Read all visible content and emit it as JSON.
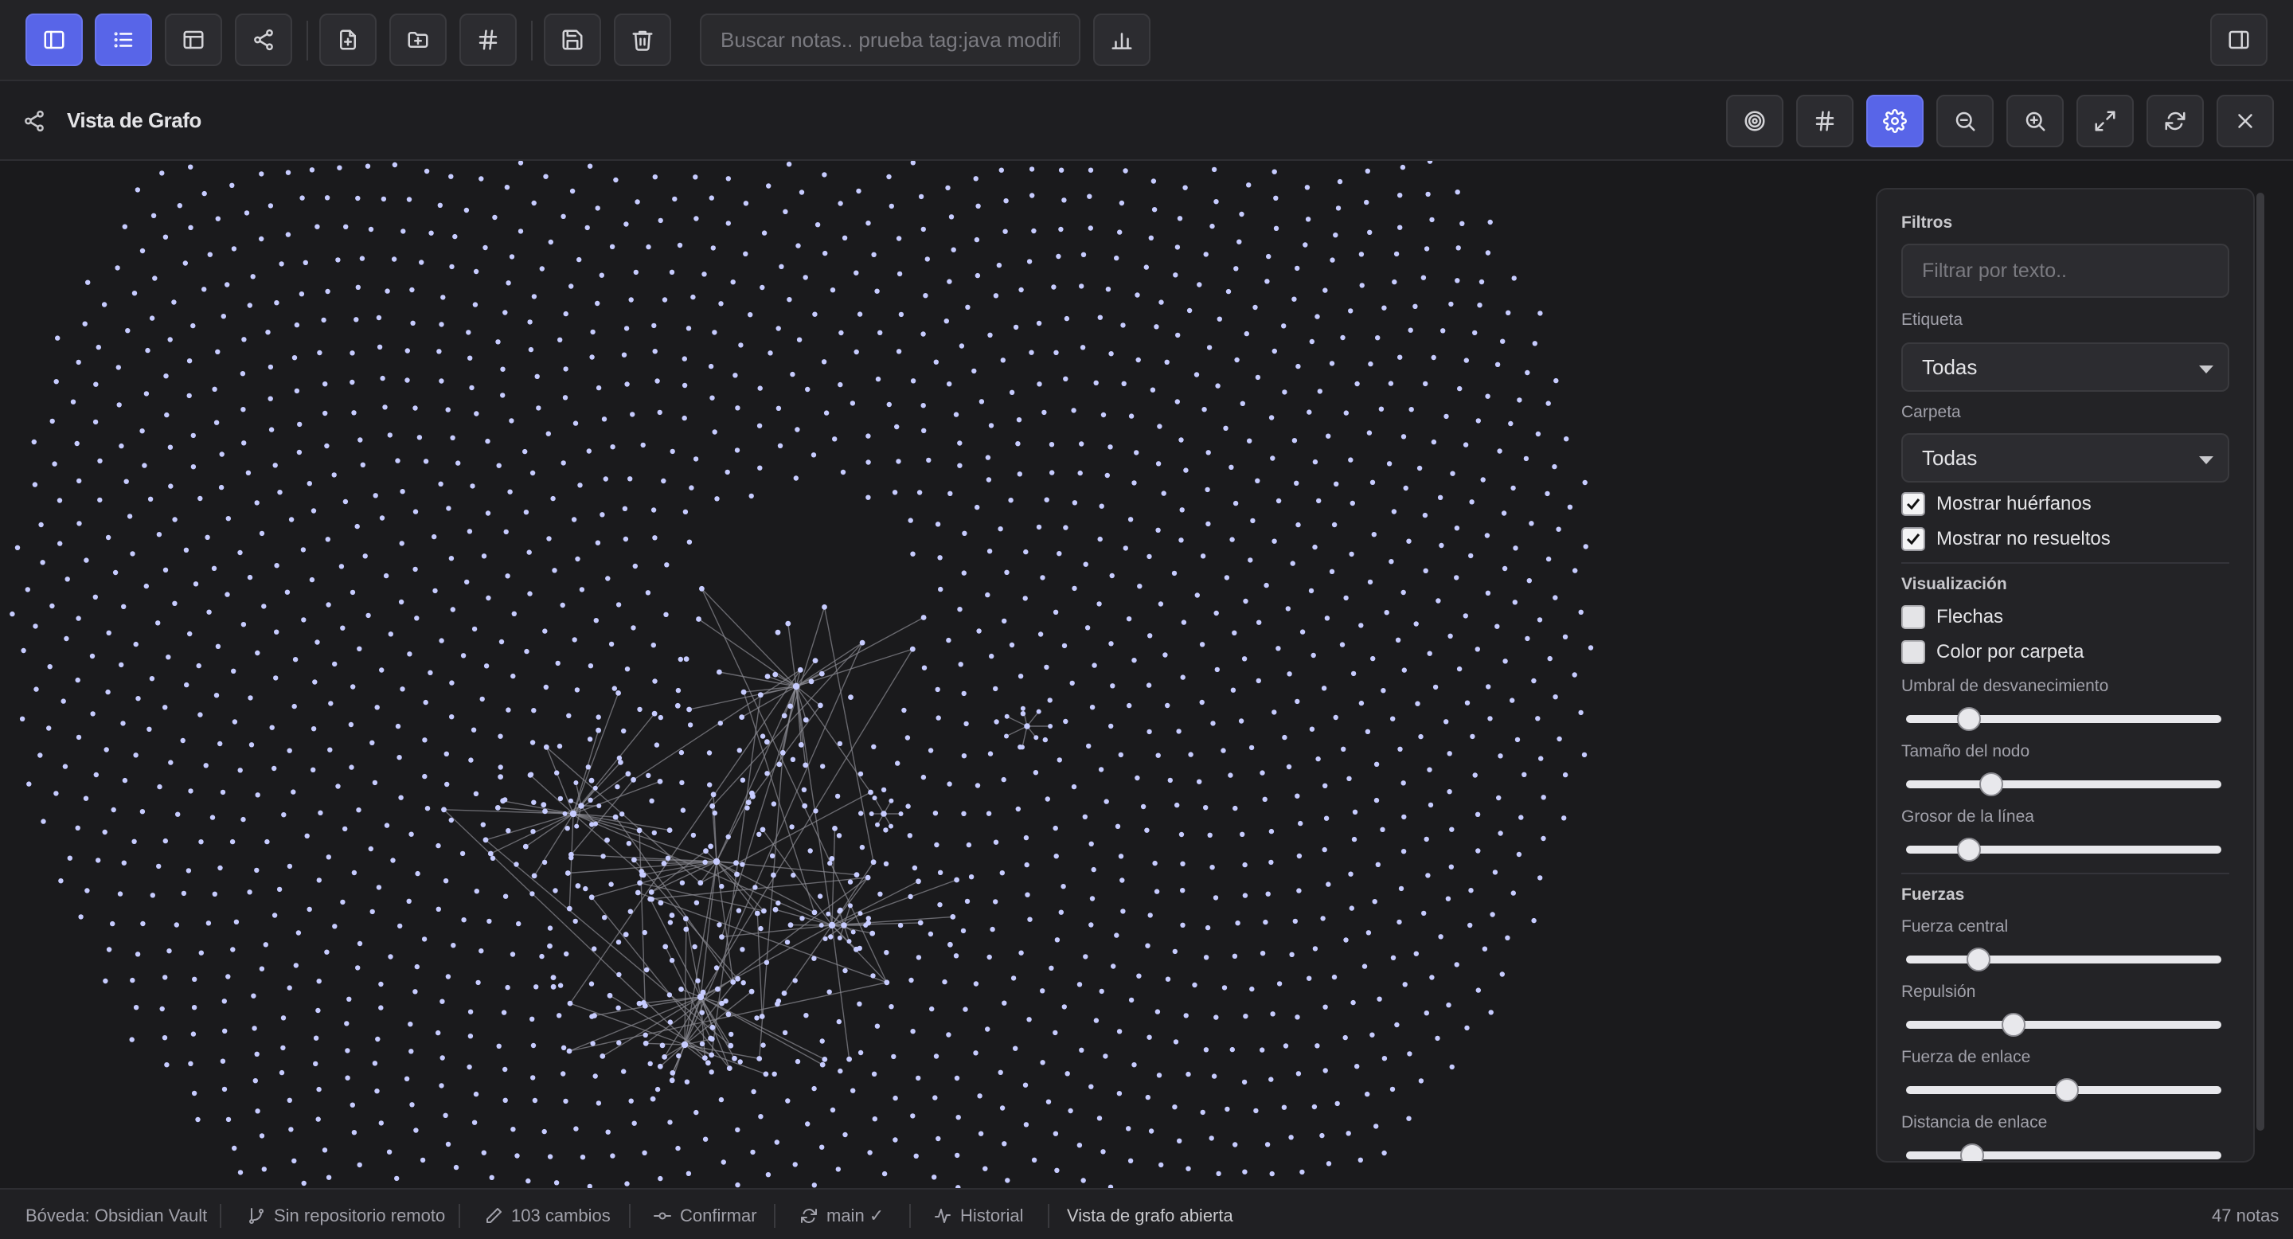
{
  "toolbar": {
    "search_placeholder": "Buscar notas.. prueba tag:java modified",
    "buttons": [
      "sidebar-toggle",
      "list-view",
      "layout",
      "graph",
      "new-note",
      "new-folder",
      "tags",
      "save",
      "delete"
    ],
    "accent_color": "#5865e8"
  },
  "graph": {
    "title": "Vista de Grafo",
    "node_color": "#c7ccff"
  },
  "settings": {
    "filters": {
      "heading": "Filtros",
      "text_placeholder": "Filtrar por texto..",
      "tag_label": "Etiqueta",
      "tag_value": "Todas",
      "folder_label": "Carpeta",
      "folder_value": "Todas",
      "show_orphans_label": "Mostrar huérfanos",
      "show_orphans": true,
      "show_unresolved_label": "Mostrar no resueltos",
      "show_unresolved": true
    },
    "display": {
      "heading": "Visualización",
      "arrows_label": "Flechas",
      "arrows": false,
      "folder_color_label": "Color por carpeta",
      "folder_color": false,
      "fade_threshold_label": "Umbral de desvanecimiento",
      "fade_threshold": 0.2,
      "node_size_label": "Tamaño del nodo",
      "node_size": 0.27,
      "line_width_label": "Grosor de la línea",
      "line_width": 0.2
    },
    "forces": {
      "heading": "Fuerzas",
      "center_label": "Fuerza central",
      "center": 0.23,
      "repel_label": "Repulsión",
      "repel": 0.34,
      "link_force_label": "Fuerza de enlace",
      "link_force": 0.51,
      "link_distance_label": "Distancia de enlace",
      "link_distance": 0.21
    }
  },
  "status": {
    "vault": "Bóveda: Obsidian Vault",
    "remote": "Sin repositorio remoto",
    "changes": "103 cambios",
    "commit": "Confirmar",
    "branch": "main ✓",
    "history": "Historial",
    "message": "Vista de grafo abierta",
    "notes_count": "47 notas"
  }
}
